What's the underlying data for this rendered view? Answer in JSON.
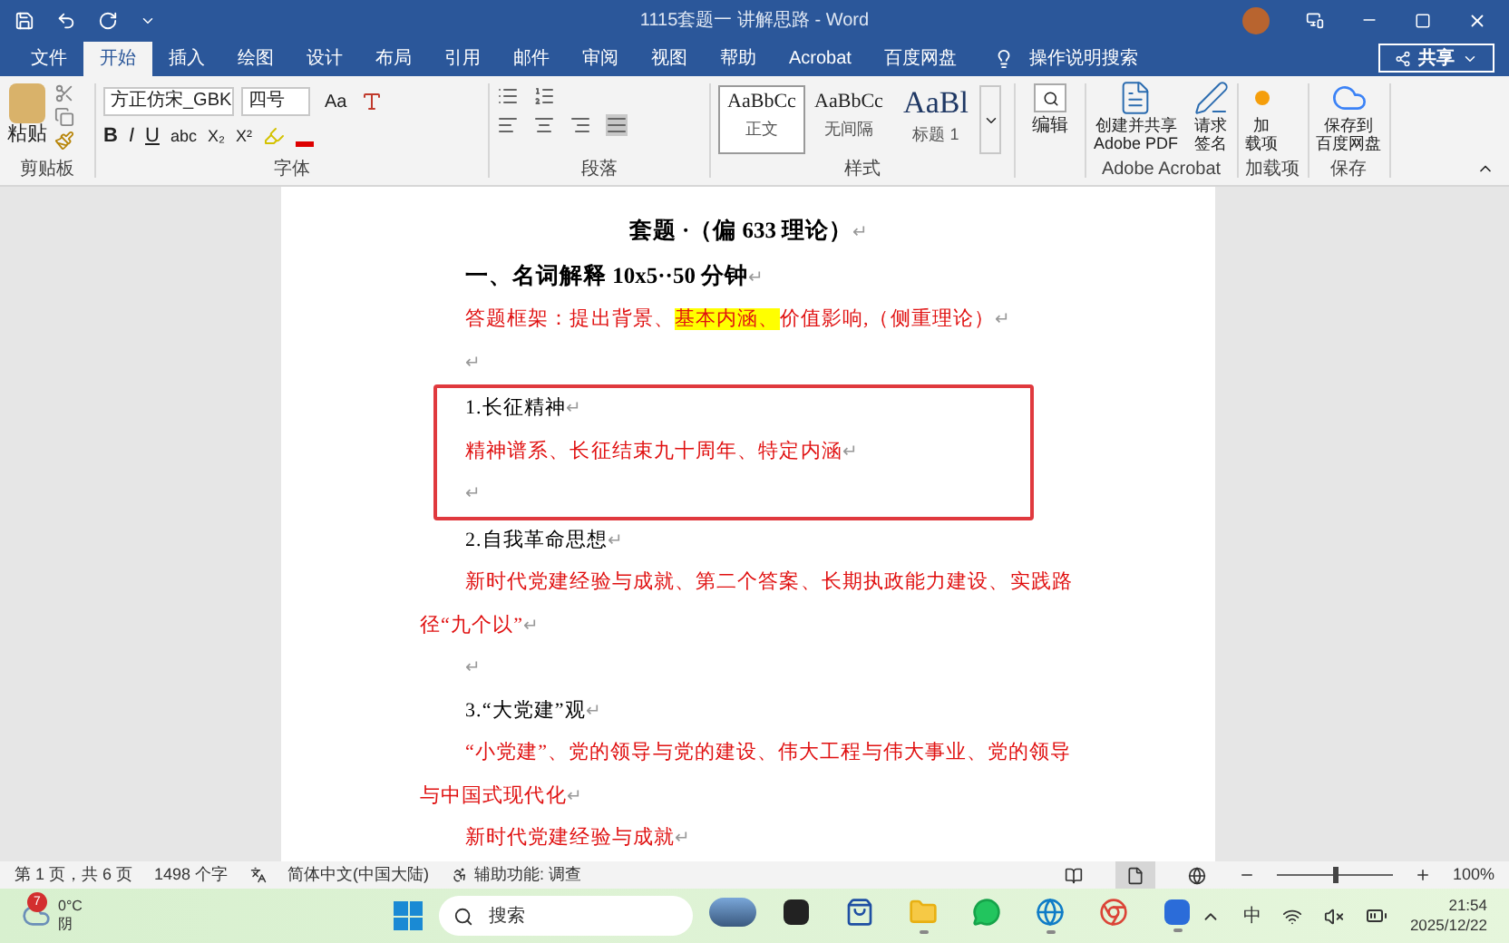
{
  "window": {
    "title": "1115套题一 讲解思路 - Word"
  },
  "tabs": [
    {
      "label": "文件",
      "selected": false
    },
    {
      "label": "开始",
      "selected": true
    },
    {
      "label": "插入",
      "selected": false
    },
    {
      "label": "绘图",
      "selected": false
    },
    {
      "label": "设计",
      "selected": false
    },
    {
      "label": "布局",
      "selected": false
    },
    {
      "label": "引用",
      "selected": false
    },
    {
      "label": "邮件",
      "selected": false
    },
    {
      "label": "审阅",
      "selected": false
    },
    {
      "label": "视图",
      "selected": false
    },
    {
      "label": "帮助",
      "selected": false
    },
    {
      "label": "Acrobat",
      "selected": false
    },
    {
      "label": "百度网盘",
      "selected": false
    }
  ],
  "tell_me": "操作说明搜索",
  "share": "共享",
  "ribbon": {
    "clipboard": {
      "paste": "粘贴",
      "label": "剪贴板"
    },
    "font": {
      "name": "方正仿宋_GBK",
      "size": "四号",
      "change_case": "Aa",
      "format_buttons": [
        "B",
        "I",
        "U",
        "abc",
        "X₂",
        "X²"
      ],
      "label": "字体"
    },
    "paragraph": {
      "label": "段落"
    },
    "styles": {
      "items": [
        {
          "preview": "AaBbCc",
          "name": "正文",
          "selected": true
        },
        {
          "preview": "AaBbCc",
          "name": "无间隔",
          "selected": false
        },
        {
          "preview": "AaBl",
          "name": "标题 1",
          "selected": false
        }
      ],
      "label": "样式"
    },
    "editing": {
      "label": "编辑"
    },
    "groups": [
      {
        "label": "Adobe Acrobat",
        "buttons": [
          {
            "kind": "pdf",
            "lines": [
              "创建并共享",
              "Adobe PDF"
            ]
          },
          {
            "kind": "sign",
            "lines": [
              "请求",
              "签名"
            ]
          }
        ]
      },
      {
        "label": "加载项",
        "buttons": [
          {
            "kind": "addin",
            "lines": [
              "加",
              "载项"
            ]
          }
        ]
      },
      {
        "label": "保存",
        "buttons": [
          {
            "kind": "cloud",
            "lines": [
              "保存到",
              "百度网盘"
            ]
          }
        ]
      }
    ]
  },
  "document": {
    "blocks": [
      {
        "kind": "title",
        "segments": [
          {
            "text": "套题 ·（偏 633 理论）",
            "highlight": false
          }
        ],
        "mark": "↵"
      },
      {
        "kind": "heading",
        "segments": [
          {
            "text": "一、名词解释 10x5··50 分钟",
            "highlight": false
          }
        ],
        "mark": "↵"
      },
      {
        "kind": "body",
        "segments": [
          {
            "text": "答题框架：提出背景、",
            "highlight": false
          },
          {
            "text": "基本内涵、",
            "highlight": true
          },
          {
            "text": "价值影响,（侧重理论）",
            "highlight": false
          }
        ],
        "mark": "↵"
      },
      {
        "kind": "empty",
        "mark": "↵"
      },
      {
        "kind": "boxed",
        "blocks": [
          {
            "kind": "item",
            "segments": [
              {
                "text": "1.长征精神",
                "highlight": false
              }
            ],
            "mark": "↵"
          },
          {
            "kind": "body",
            "segments": [
              {
                "text": "精神谱系、长征结束九十周年、特定内涵",
                "highlight": false
              }
            ],
            "mark": "↵"
          },
          {
            "kind": "empty",
            "mark": "↵"
          }
        ]
      },
      {
        "kind": "item",
        "segments": [
          {
            "text": "2.自我革命思想",
            "highlight": false
          }
        ],
        "mark": "↵"
      },
      {
        "kind": "body",
        "segments": [
          {
            "text": "新时代党建经验与成就、第二个答案、长期执政能力建设、实践路径“九个以”",
            "highlight": false
          }
        ],
        "mark": "↵"
      },
      {
        "kind": "empty",
        "mark": "↵"
      },
      {
        "kind": "item",
        "segments": [
          {
            "text": "3.“大党建”观",
            "highlight": false
          }
        ],
        "mark": "↵"
      },
      {
        "kind": "body",
        "segments": [
          {
            "text": "“小党建”、党的领导与党的建设、伟大工程与伟大事业、党的领导与中国式现代化",
            "highlight": false
          }
        ],
        "mark": "↵"
      },
      {
        "kind": "body",
        "segments": [
          {
            "text": "新时代党建经验与成就",
            "highlight": false
          }
        ],
        "mark": "↵"
      }
    ]
  },
  "status_bar": {
    "page": "第 1 页，共 6 页",
    "words": "1498 个字",
    "language": "简体中文(中国大陆)",
    "accessibility": "辅助功能: 调查",
    "views": [
      {
        "kind": "read",
        "selected": false
      },
      {
        "kind": "print",
        "selected": true
      },
      {
        "kind": "web",
        "selected": false
      }
    ],
    "zoom": {
      "level": 0.5,
      "reading": "100%"
    }
  },
  "taskbar": {
    "weather": {
      "badge": "7",
      "temperature": "0°C",
      "condition": "阴"
    },
    "search": {
      "placeholder": "搜索"
    },
    "apps": [
      {
        "kind": "landscape",
        "running": false
      },
      {
        "kind": "terminal",
        "running": false
      },
      {
        "kind": "store",
        "running": false
      },
      {
        "kind": "folder",
        "running": true
      },
      {
        "kind": "chat",
        "running": false
      },
      {
        "kind": "edge",
        "running": true
      },
      {
        "kind": "chrome",
        "running": false
      },
      {
        "kind": "word",
        "running": true
      }
    ],
    "ime": "中",
    "time": "21:54",
    "date": "2025/12/22"
  }
}
